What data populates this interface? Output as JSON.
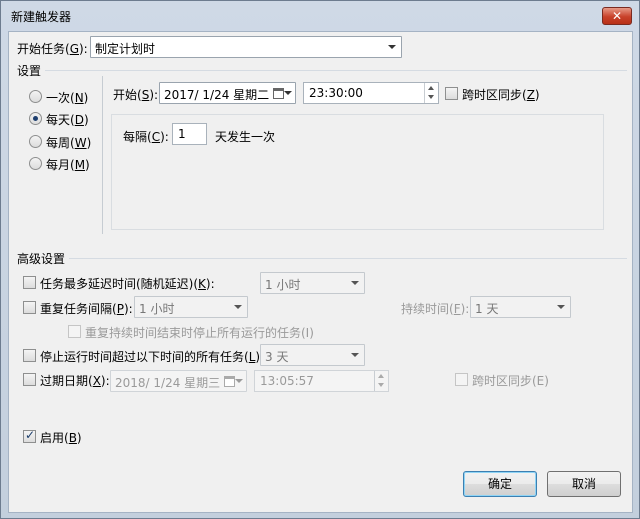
{
  "window": {
    "title": "新建触发器",
    "close_label": "✕"
  },
  "start_task": {
    "label_prefix": "开始任务(",
    "label_accel": "G",
    "label_suffix": "):",
    "value": "制定计划时"
  },
  "settings": {
    "group_title": "设置",
    "radios": [
      {
        "prefix": "一次(",
        "accel": "N",
        "suffix": ")",
        "checked": false
      },
      {
        "prefix": "每天(",
        "accel": "D",
        "suffix": ")",
        "checked": true
      },
      {
        "prefix": "每周(",
        "accel": "W",
        "suffix": ")",
        "checked": false
      },
      {
        "prefix": "每月(",
        "accel": "M",
        "suffix": ")",
        "checked": false
      }
    ],
    "start_label_prefix": "开始(",
    "start_label_accel": "S",
    "start_label_suffix": "):",
    "start_date": "2017/  1/24 星期二",
    "start_time": "23:30:00",
    "sync_tz_prefix": "跨时区同步(",
    "sync_tz_accel": "Z",
    "sync_tz_suffix": ")",
    "interval_prefix": "每隔(",
    "interval_accel": "C",
    "interval_suffix": "):",
    "interval_value": "1",
    "interval_unit": "天发生一次"
  },
  "advanced": {
    "group_title": "高级设置",
    "delay": {
      "prefix": "任务最多延迟时间(随机延迟)(",
      "accel": "K",
      "suffix": "):",
      "value": "1 小时",
      "checked": false
    },
    "repeat": {
      "prefix": "重复任务间隔(",
      "accel": "P",
      "suffix": "):",
      "value": "1 小时",
      "checked": false,
      "duration_prefix": "持续时间(",
      "duration_accel": "F",
      "duration_suffix": "):",
      "duration_value": "1 天",
      "stop_all_label": "重复持续时间结束时停止所有运行的任务(I)"
    },
    "stop_if_longer": {
      "prefix": "停止运行时间超过以下时间的所有任务(",
      "accel": "L",
      "suffix": "):",
      "value": "3 天",
      "checked": false
    },
    "expire": {
      "prefix": "过期日期(",
      "accel": "X",
      "suffix": "):",
      "date": "2018/  1/24 星期三",
      "time": "13:05:57",
      "sync_tz_label": "跨时区同步(E)",
      "checked": false
    },
    "enabled": {
      "prefix": "启用(",
      "accel": "B",
      "suffix": ")",
      "checked": true
    }
  },
  "buttons": {
    "ok": "确定",
    "cancel": "取消"
  }
}
